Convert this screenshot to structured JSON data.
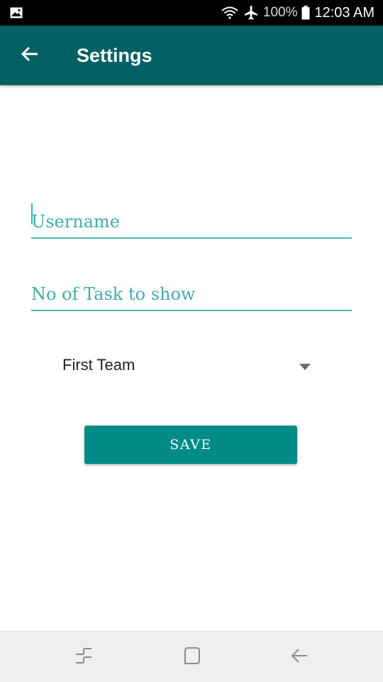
{
  "status_bar": {
    "icons": [
      "gallery-icon",
      "wifi-icon",
      "airplane-icon",
      "battery-icon"
    ],
    "battery": "100%",
    "time": "12:03 AM"
  },
  "app_bar": {
    "title": "Settings",
    "back_icon": "arrow-back-icon",
    "color": "#006064"
  },
  "form": {
    "username": {
      "value": "",
      "placeholder": "Username"
    },
    "task_count": {
      "value": "",
      "placeholder": "No of Task to show"
    },
    "team_select": {
      "selected": "First Team"
    },
    "save_label": "SAVE",
    "accent": "#008b87"
  },
  "nav_bar": {
    "icons": [
      "recent-apps-icon",
      "home-icon",
      "back-icon"
    ]
  }
}
